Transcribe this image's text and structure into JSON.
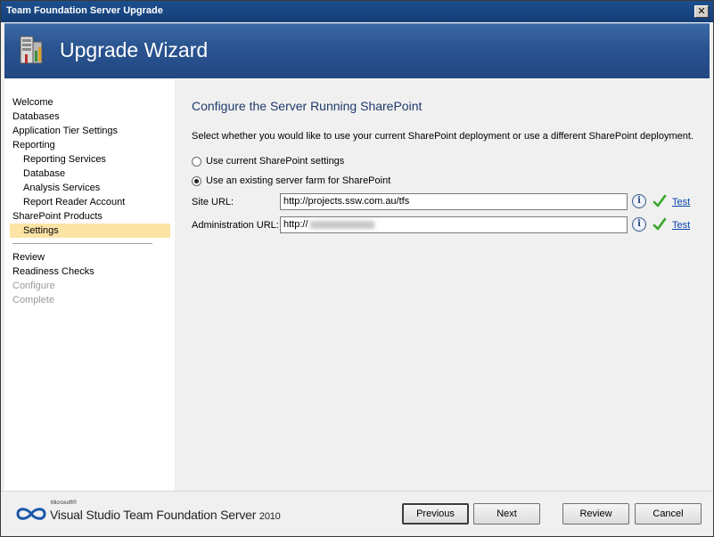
{
  "window": {
    "title": "Team Foundation Server Upgrade",
    "close_label": "✕"
  },
  "banner": {
    "heading": "Upgrade Wizard"
  },
  "sidebar": {
    "items": [
      {
        "label": "Welcome",
        "level": 0,
        "state": "normal"
      },
      {
        "label": "Databases",
        "level": 0,
        "state": "normal"
      },
      {
        "label": "Application Tier Settings",
        "level": 0,
        "state": "normal"
      },
      {
        "label": "Reporting",
        "level": 0,
        "state": "normal"
      },
      {
        "label": "Reporting Services",
        "level": 1,
        "state": "normal"
      },
      {
        "label": "Database",
        "level": 1,
        "state": "normal"
      },
      {
        "label": "Analysis Services",
        "level": 1,
        "state": "normal"
      },
      {
        "label": "Report Reader Account",
        "level": 1,
        "state": "normal"
      },
      {
        "label": "SharePoint Products",
        "level": 0,
        "state": "normal"
      },
      {
        "label": "Settings",
        "level": 1,
        "state": "active"
      }
    ],
    "lower_items": [
      {
        "label": "Review",
        "state": "normal"
      },
      {
        "label": "Readiness Checks",
        "state": "normal"
      },
      {
        "label": "Configure",
        "state": "disabled"
      },
      {
        "label": "Complete",
        "state": "disabled"
      }
    ]
  },
  "main": {
    "heading": "Configure the Server Running SharePoint",
    "description": "Select whether you would like to use your current SharePoint deployment or use a different SharePoint deployment.",
    "options": [
      {
        "label": "Use current SharePoint settings",
        "selected": false
      },
      {
        "label": "Use an existing server farm for SharePoint",
        "selected": true
      }
    ],
    "site_url": {
      "label": "Site URL:",
      "value": "http://projects.ssw.com.au/tfs",
      "test_label": "Test"
    },
    "admin_url": {
      "label": "Administration URL:",
      "value": "http://",
      "test_label": "Test"
    },
    "info_glyph": "i",
    "icons": [
      "info-icon",
      "check-icon"
    ]
  },
  "footer": {
    "brand_small": "Microsoft®",
    "brand_main": "Visual Studio Team Foundation Server",
    "brand_year": "2010",
    "buttons": {
      "previous": "Previous",
      "next": "Next",
      "review": "Review",
      "cancel": "Cancel"
    }
  },
  "colors": {
    "banner": "#2b5591",
    "active_item": "#fbe4a6",
    "check": "#3aa62a",
    "link": "#0645ad"
  }
}
